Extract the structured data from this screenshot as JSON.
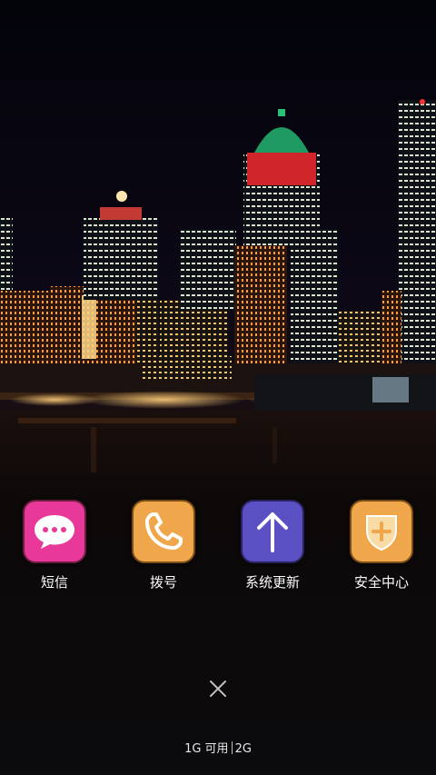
{
  "apps": [
    {
      "label": "短信",
      "icon": "message-bubble-icon",
      "color": "#e8399a"
    },
    {
      "label": "拨号",
      "icon": "phone-handset-icon",
      "color": "#f0a64a"
    },
    {
      "label": "系统更新",
      "icon": "arrow-up-icon",
      "color": "#5b4fc4"
    },
    {
      "label": "安全中心",
      "icon": "shield-plus-icon",
      "color": "#f0a64a"
    }
  ],
  "close_icon": "close-icon",
  "memory": {
    "used_text": "1G 可用",
    "total_text": "2G"
  }
}
